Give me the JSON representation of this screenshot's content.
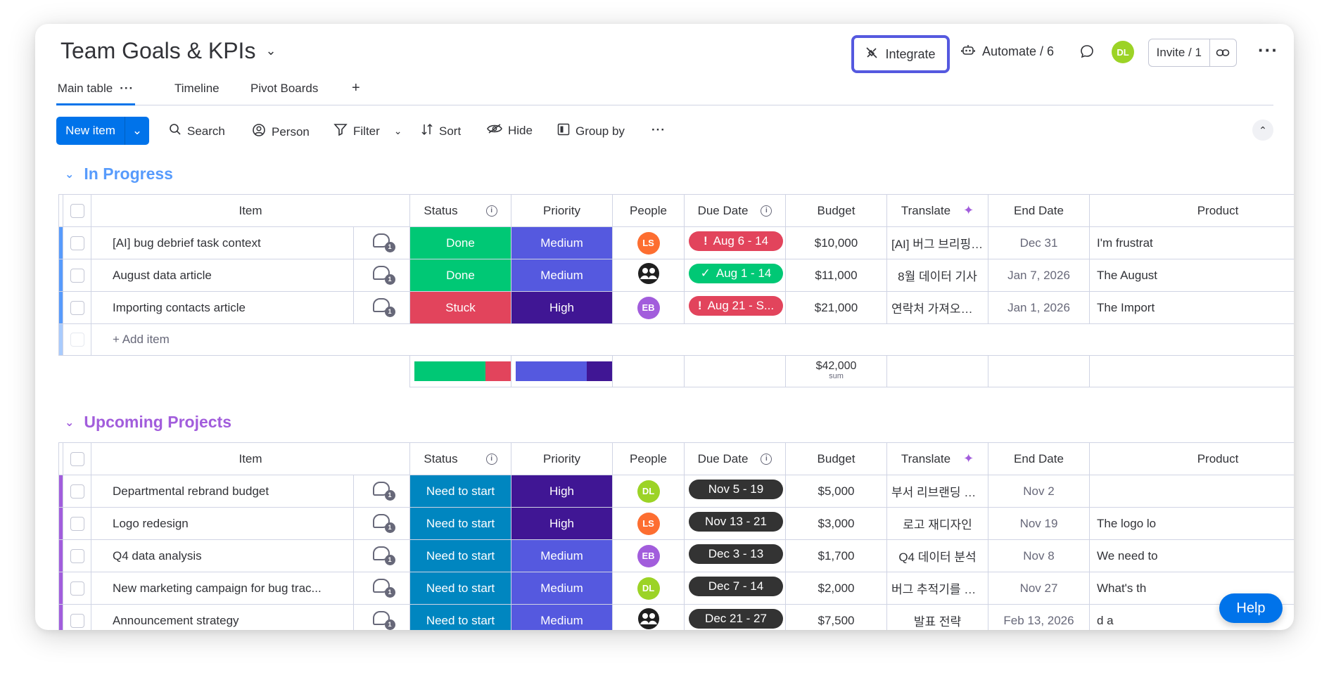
{
  "board": {
    "title": "Team Goals & KPIs"
  },
  "header": {
    "integrate_label": "Integrate",
    "automate_label": "Automate / 6",
    "user_initials": "DL",
    "invite_label": "Invite / 1"
  },
  "tabs": [
    {
      "label": "Main table"
    },
    {
      "label": "Timeline"
    },
    {
      "label": "Pivot Boards"
    },
    {
      "label": "+"
    }
  ],
  "toolbar": {
    "new_item": "New item",
    "search": "Search",
    "person": "Person",
    "filter": "Filter",
    "sort": "Sort",
    "hide": "Hide",
    "group_by": "Group by"
  },
  "columns": {
    "item": "Item",
    "status": "Status",
    "priority": "Priority",
    "people": "People",
    "due_date": "Due Date",
    "budget": "Budget",
    "translate": "Translate",
    "end_date": "End Date",
    "product": "Product"
  },
  "colors": {
    "done": "#00c875",
    "stuck": "#e2445c",
    "need_to_start": "#0086c0",
    "medium": "#5559df",
    "high": "#401694",
    "group1": "#579bfc",
    "group2": "#a25ddc"
  },
  "groups": [
    {
      "title": "In Progress",
      "rows": [
        {
          "item": "[AI] bug debrief task context",
          "status": "Done",
          "priority": "Medium",
          "person": "LS",
          "due": "Aug 6 - 14",
          "due_mark": "!",
          "budget": "$10,000",
          "translate": "[AI] 버그 브리핑 작...",
          "end": "Dec 31",
          "product": "I'm frustrat"
        },
        {
          "item": "August data article",
          "status": "Done",
          "priority": "Medium",
          "person": "",
          "due": "Aug 1 - 14",
          "due_mark": "✓",
          "budget": "$11,000",
          "translate": "8월 데이터 기사",
          "end": "Jan 7, 2026",
          "product": "The August"
        },
        {
          "item": "Importing contacts article",
          "status": "Stuck",
          "priority": "High",
          "person": "EB",
          "due": "Aug 21 - S...",
          "due_mark": "!",
          "budget": "$21,000",
          "translate": "연락처 가져오기 기사",
          "end": "Jan 1, 2026",
          "product": "The Import"
        }
      ],
      "add_item": "+ Add item",
      "summary": {
        "budget_sum": "$42,000",
        "sum_label": "sum"
      }
    },
    {
      "title": "Upcoming Projects",
      "rows": [
        {
          "item": "Departmental rebrand budget",
          "status": "Need to start",
          "priority": "High",
          "person": "DL",
          "due": "Nov 5 - 19",
          "budget": "$5,000",
          "translate": "부서 리브랜딩 예산",
          "end": "Nov 2",
          "product": ""
        },
        {
          "item": "Logo redesign",
          "status": "Need to start",
          "priority": "High",
          "person": "LS",
          "due": "Nov 13 - 21",
          "budget": "$3,000",
          "translate": "로고 재디자인",
          "end": "Nov 19",
          "product": "The logo lo"
        },
        {
          "item": "Q4 data analysis",
          "status": "Need to start",
          "priority": "Medium",
          "person": "EB",
          "due": "Dec 3 - 13",
          "budget": "$1,700",
          "translate": "Q4 데이터 분석",
          "end": "Nov 8",
          "product": "We need to"
        },
        {
          "item": "New marketing campaign for bug trac...",
          "status": "Need to start",
          "priority": "Medium",
          "person": "DL",
          "due": "Dec 7 - 14",
          "budget": "$2,000",
          "translate": "버그 추적기를 위한 ...",
          "end": "Nov 27",
          "product": "What's th"
        },
        {
          "item": "Announcement strategy",
          "status": "Need to start",
          "priority": "Medium",
          "person": "",
          "due": "Dec 21 - 27",
          "budget": "$7,500",
          "translate": "발표 전략",
          "end": "Feb 13, 2026",
          "product": "d a"
        }
      ]
    }
  ],
  "comment_count": "1",
  "help_label": "Help"
}
